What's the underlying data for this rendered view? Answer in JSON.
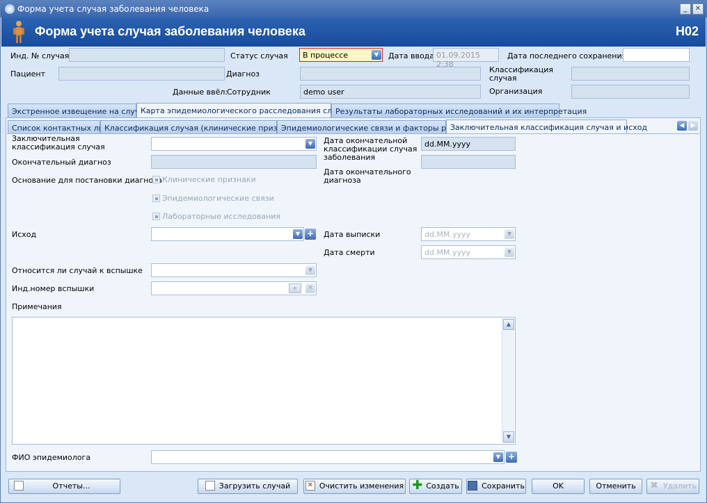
{
  "window": {
    "title": "Форма учета случая заболевания человека"
  },
  "header": {
    "title": "Форма учета случая заболевания человека",
    "code": "H02"
  },
  "top": {
    "case_id_label": "Инд. № случая",
    "case_status_label": "Статус случая",
    "case_status_value": "В процессе",
    "entry_date_label": "Дата ввода",
    "entry_date_value": "01.09.2015 2:38",
    "last_save_label": "Дата последнего сохранения",
    "patient_label": "Пациент",
    "diagnosis_label": "Диагноз",
    "classification_label": "Классификация случая",
    "entered_by_label": "Данные ввёл:",
    "employee_label": "Сотрудник",
    "employee_value": "demo user",
    "organization_label": "Организация"
  },
  "tabs_main": [
    {
      "label": "Экстренное извещение на случай"
    },
    {
      "label": "Карта эпидемиологического расследования случая"
    },
    {
      "label": "Результаты лабораторных исследований и их интерпретация"
    }
  ],
  "tabs_sub": [
    {
      "label": "Список контактных лиц"
    },
    {
      "label": "Классификация случая (клинические признаки)"
    },
    {
      "label": "Эпидемиологические связи и факторы риска"
    },
    {
      "label": "Заключительная классификация случая и исход"
    }
  ],
  "form": {
    "final_classification_label": "Заключительная классификация случая",
    "final_classification_date_label": "Дата окончательной классификации случая заболевания",
    "final_classification_date_value": "dd.MM.yyyy",
    "final_diagnosis_label": "Окончательный диагноз",
    "final_diagnosis_date_label": "Дата окончательного диагноза",
    "basis_label": "Основание для постановки диагноза",
    "basis_options": [
      "Клинические признаки",
      "Эпидемиологические связи",
      "Лабораторные исследования"
    ],
    "outcome_label": "Исход",
    "discharge_date_label": "Дата выписки",
    "discharge_date_value": "dd.MM.yyyy",
    "death_date_label": "Дата смерти",
    "death_date_value": "dd.MM.yyyy",
    "outbreak_label": "Относится ли случай к вспышке",
    "outbreak_id_label": "Инд.номер вспышки",
    "notes_label": "Примечания",
    "epidemiologist_label": "ФИО эпидемиолога"
  },
  "footer": {
    "reports": "Отчеты...",
    "load_case": "Загрузить случай",
    "clear_changes": "Очистить изменения",
    "create": "Создать",
    "save": "Сохранить",
    "ok": "OK",
    "cancel": "Отменить",
    "delete": "Удалить"
  },
  "colors": {
    "header_bg": "#1f55a6",
    "status_border": "#d62020",
    "status_bg": "#fdf6c6"
  }
}
